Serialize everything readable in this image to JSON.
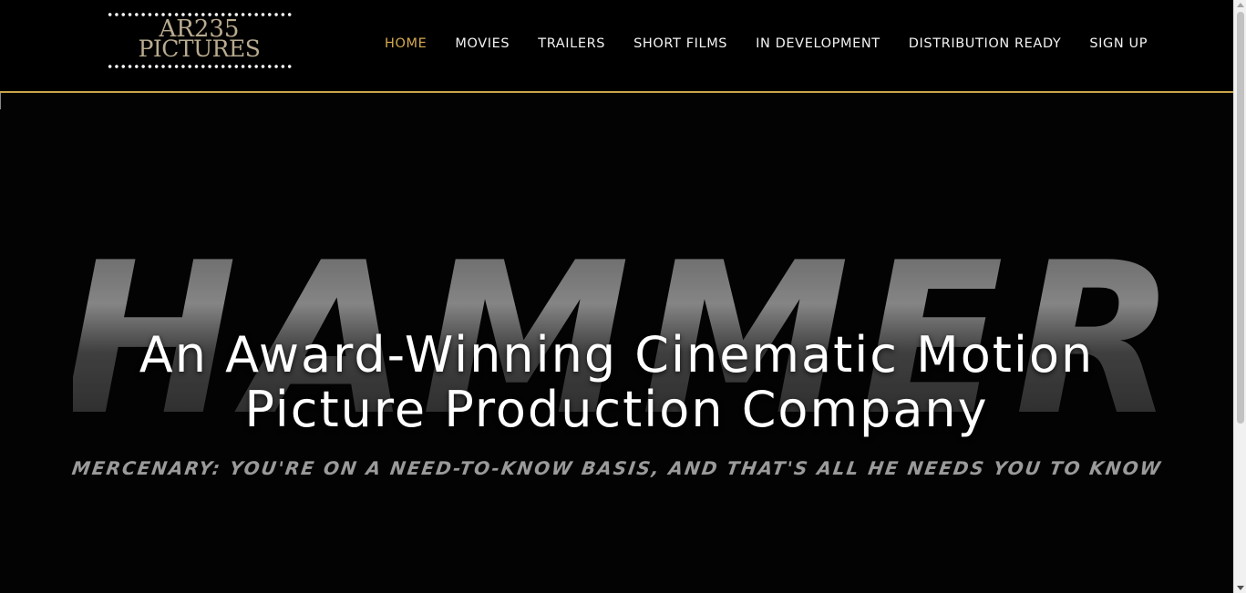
{
  "logo": {
    "line1": "AR235",
    "line2": "PICTURES"
  },
  "nav": {
    "items": [
      {
        "label": "HOME",
        "active": true
      },
      {
        "label": "MOVIES",
        "active": false
      },
      {
        "label": "TRAILERS",
        "active": false
      },
      {
        "label": "SHORT FILMS",
        "active": false
      },
      {
        "label": "IN DEVELOPMENT",
        "active": false
      },
      {
        "label": "DISTRIBUTION READY",
        "active": false
      },
      {
        "label": "SIGN UP",
        "active": false
      }
    ]
  },
  "hero": {
    "background_word": "HAMMER",
    "background_tagline": "MERCENARY: YOU'RE ON A NEED-TO-KNOW BASIS, AND THAT'S ALL HE NEEDS YOU TO KNOW",
    "title_line1": "An Award-Winning Cinematic Motion",
    "title_line2": "Picture Production Company"
  },
  "colors": {
    "accent": "#d4aa4e",
    "header_border": "#c9a54a",
    "background": "#000000",
    "nav_text": "#f3f3f3",
    "hero_text": "#ffffff"
  }
}
